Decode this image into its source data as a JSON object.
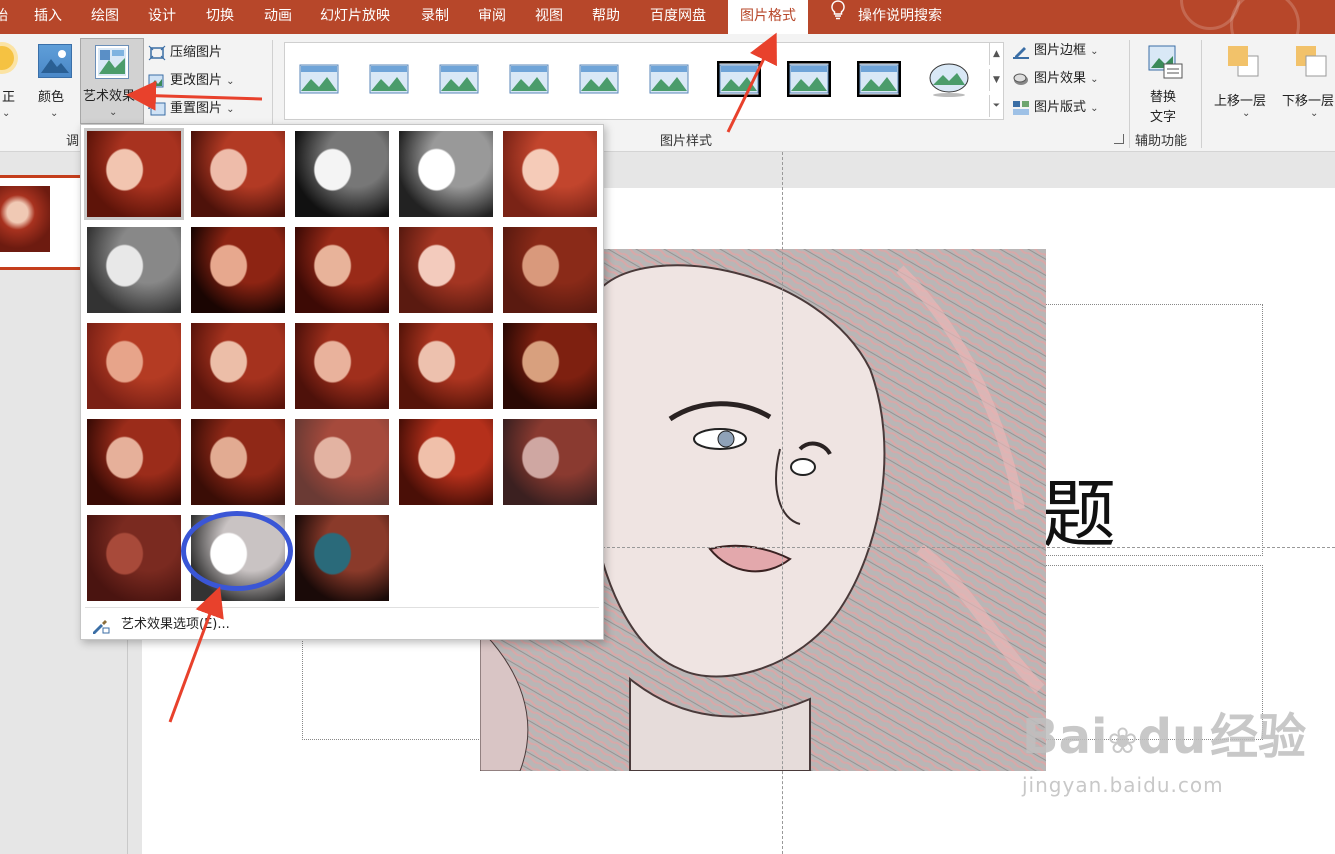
{
  "tabs": [
    {
      "label": "始",
      "active": false
    },
    {
      "label": "插入",
      "active": false
    },
    {
      "label": "绘图",
      "active": false
    },
    {
      "label": "设计",
      "active": false
    },
    {
      "label": "切换",
      "active": false
    },
    {
      "label": "动画",
      "active": false
    },
    {
      "label": "幻灯片放映",
      "active": false
    },
    {
      "label": "录制",
      "active": false
    },
    {
      "label": "审阅",
      "active": false
    },
    {
      "label": "视图",
      "active": false
    },
    {
      "label": "帮助",
      "active": false
    },
    {
      "label": "百度网盘",
      "active": false
    },
    {
      "label": "图片格式",
      "active": true
    }
  ],
  "search": {
    "icon": "lightbulb-icon",
    "label": "操作说明搜索"
  },
  "ribbon": {
    "corrections_label": "正",
    "color_label": "颜色",
    "art_effects_label": "艺术效果",
    "compress_label": "压缩图片",
    "change_label": "更改图片",
    "reset_label": "重置图片",
    "adjust_group": "调",
    "styles_group": "图片样式",
    "border_label": "图片边框",
    "effects_label": "图片效果",
    "layout_label": "图片版式",
    "alt_text_line1": "替换",
    "alt_text_line2": "文字",
    "accessibility_group": "辅助功能",
    "bring_forward": "上移一层",
    "send_backward": "下移一层"
  },
  "dropdown": {
    "effects_count": 23,
    "selected_index": 0,
    "highlighted_index": 21,
    "options_label": "艺术效果选项(E)..."
  },
  "slide": {
    "title_fragment": "题"
  },
  "watermark": {
    "brand": "Bai",
    "brand2": "du",
    "cn": "经验",
    "url": "jingyan.baidu.com"
  },
  "colors": {
    "accent": "#b7472a",
    "highlight_ring": "#3a56d6",
    "arrow": "#e8412c"
  }
}
